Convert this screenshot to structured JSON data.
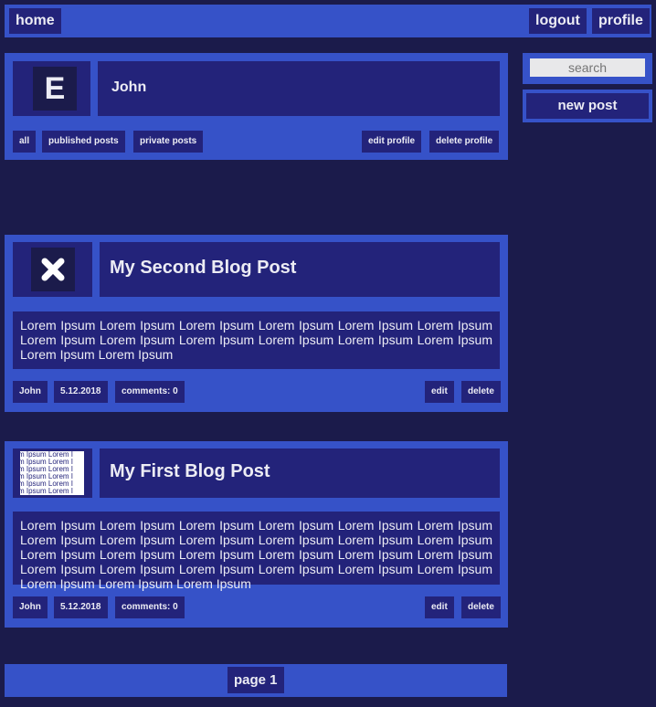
{
  "nav": {
    "home": "home",
    "logout": "logout",
    "profile": "profile"
  },
  "sidebar": {
    "search_placeholder": "search",
    "new_post": "new post"
  },
  "profile_card": {
    "avatar_letter": "E",
    "name": "John",
    "filters": [
      "all",
      "published posts",
      "private posts"
    ],
    "edit_profile": "edit profile",
    "delete_profile": "delete profile"
  },
  "posts": [
    {
      "title": "My Second Blog Post",
      "thumbnail_icon": "close-x-icon",
      "body": "Lorem Ipsum Lorem Ipsum Lorem Ipsum Lorem Ipsum Lorem Ipsum Lorem Ipsum Lorem Ipsum Lorem Ipsum Lorem Ipsum Lorem Ipsum Lorem Ipsum Lorem Ipsum Lorem Ipsum Lorem Ipsum",
      "author": "John",
      "date": "5.12.2018",
      "comments": "comments: 0",
      "edit": "edit",
      "delete": "delete"
    },
    {
      "title": "My First Blog Post",
      "thumbnail_text": "m Ipsum Lorem I",
      "body": "Lorem Ipsum Lorem Ipsum Lorem Ipsum Lorem Ipsum Lorem Ipsum Lorem Ipsum Lorem Ipsum Lorem Ipsum Lorem Ipsum Lorem Ipsum Lorem Ipsum Lorem Ipsum Lorem Ipsum Lorem Ipsum Lorem Ipsum Lorem Ipsum Lorem Ipsum Lorem Ipsum Lorem Ipsum Lorem Ipsum Lorem Ipsum Lorem Ipsum Lorem Ipsum Lorem Ipsum Lorem Ipsum Lorem Ipsum Lorem Ipsum",
      "author": "John",
      "date": "5.12.2018",
      "comments": "comments: 0",
      "edit": "edit",
      "delete": "delete"
    }
  ],
  "pagination": {
    "label": "page 1"
  },
  "colors": {
    "background": "#1b1b4b",
    "panel": "#3652c8",
    "dark_box": "#23237a",
    "text": "#ececf4"
  }
}
